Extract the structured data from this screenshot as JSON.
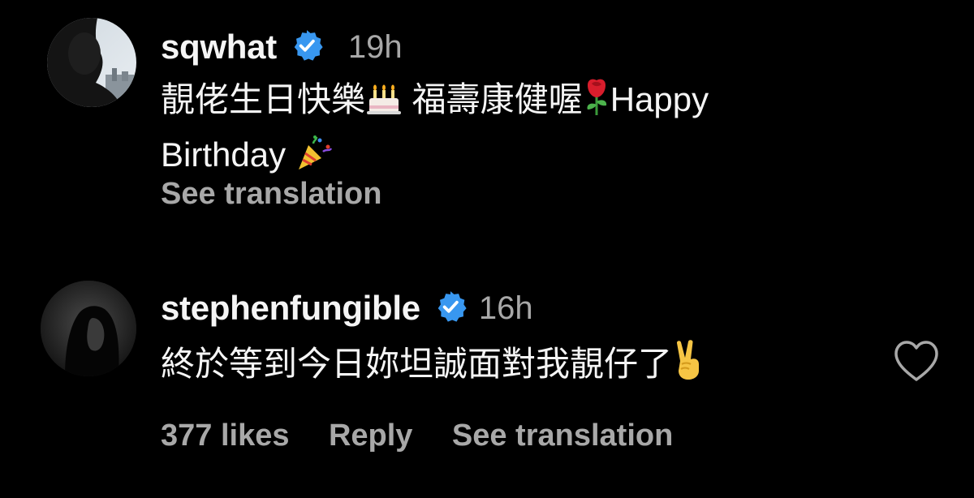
{
  "comments": [
    {
      "username": "sqwhat",
      "verified": true,
      "timestamp": "19h",
      "text_line1_part1": "靚佬生日快樂",
      "text_line1_part2": " 福壽康健喔",
      "text_line1_part3": "Happy",
      "text_line2": "Birthday ",
      "emojis": [
        "birthday-cake-icon",
        "rose-icon",
        "party-popper-icon"
      ],
      "see_translation": "See translation"
    },
    {
      "username": "stephenfungible",
      "verified": true,
      "timestamp": "16h",
      "text": "終於等到今日妳坦誠面對我靚仔了",
      "emojis": [
        "victory-hand-icon"
      ],
      "likes": "377 likes",
      "reply": "Reply",
      "see_translation": "See translation"
    }
  ],
  "colors": {
    "background": "#000000",
    "primary_text": "#f5f5f5",
    "secondary_text": "#a8a8a8",
    "verified_blue": "#3897f0"
  },
  "icons": {
    "verified": "verified-badge-icon",
    "like": "heart-outline-icon"
  }
}
